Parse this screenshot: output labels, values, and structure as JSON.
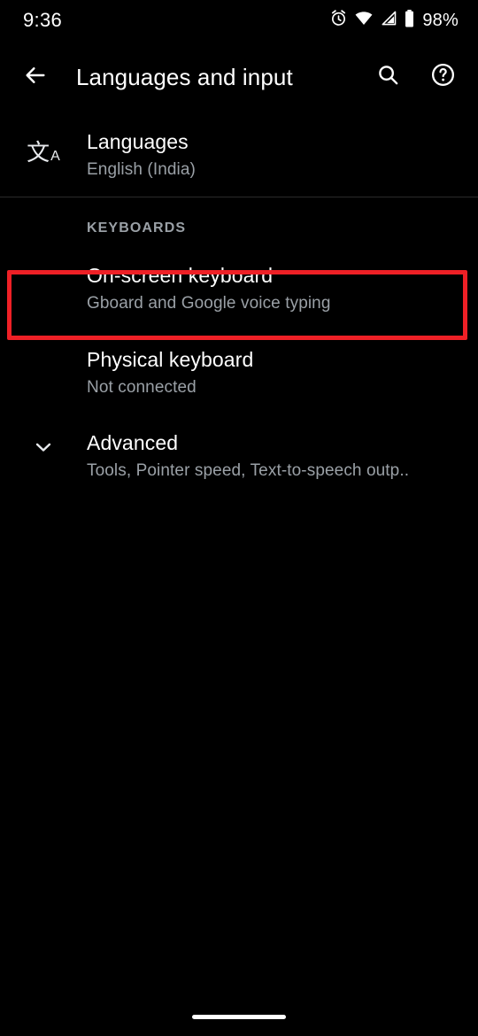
{
  "status_bar": {
    "time": "9:36",
    "battery_percent": "98%",
    "icons": [
      "alarm-icon",
      "wifi-icon",
      "cellular-signal-icon",
      "battery-icon"
    ]
  },
  "app_bar": {
    "back_icon": "back-arrow-icon",
    "title": "Languages and input",
    "search_icon": "search-icon",
    "help_icon": "help-circle-icon"
  },
  "content": {
    "languages": {
      "icon": "translate-icon",
      "icon_glyph_cjk": "文",
      "icon_glyph_latin": "A",
      "title": "Languages",
      "summary": "English (India)"
    },
    "section_keyboards": {
      "header": "KEYBOARDS",
      "items": [
        {
          "title": "On-screen keyboard",
          "summary": "Gboard and Google voice typing",
          "highlighted": true
        },
        {
          "title": "Physical keyboard",
          "summary": "Not connected",
          "highlighted": false
        }
      ]
    },
    "advanced": {
      "icon": "chevron-down-icon",
      "title": "Advanced",
      "summary": "Tools, Pointer speed, Text-to-speech outp.."
    }
  },
  "highlight": {
    "color": "#ee2026"
  },
  "nav": {
    "gesture_pill": "home-gesture-pill"
  },
  "theme": {
    "background": "#000000",
    "primary_text": "#ffffff",
    "secondary_text": "#9aa0a6",
    "divider": "#2a2a2a"
  }
}
